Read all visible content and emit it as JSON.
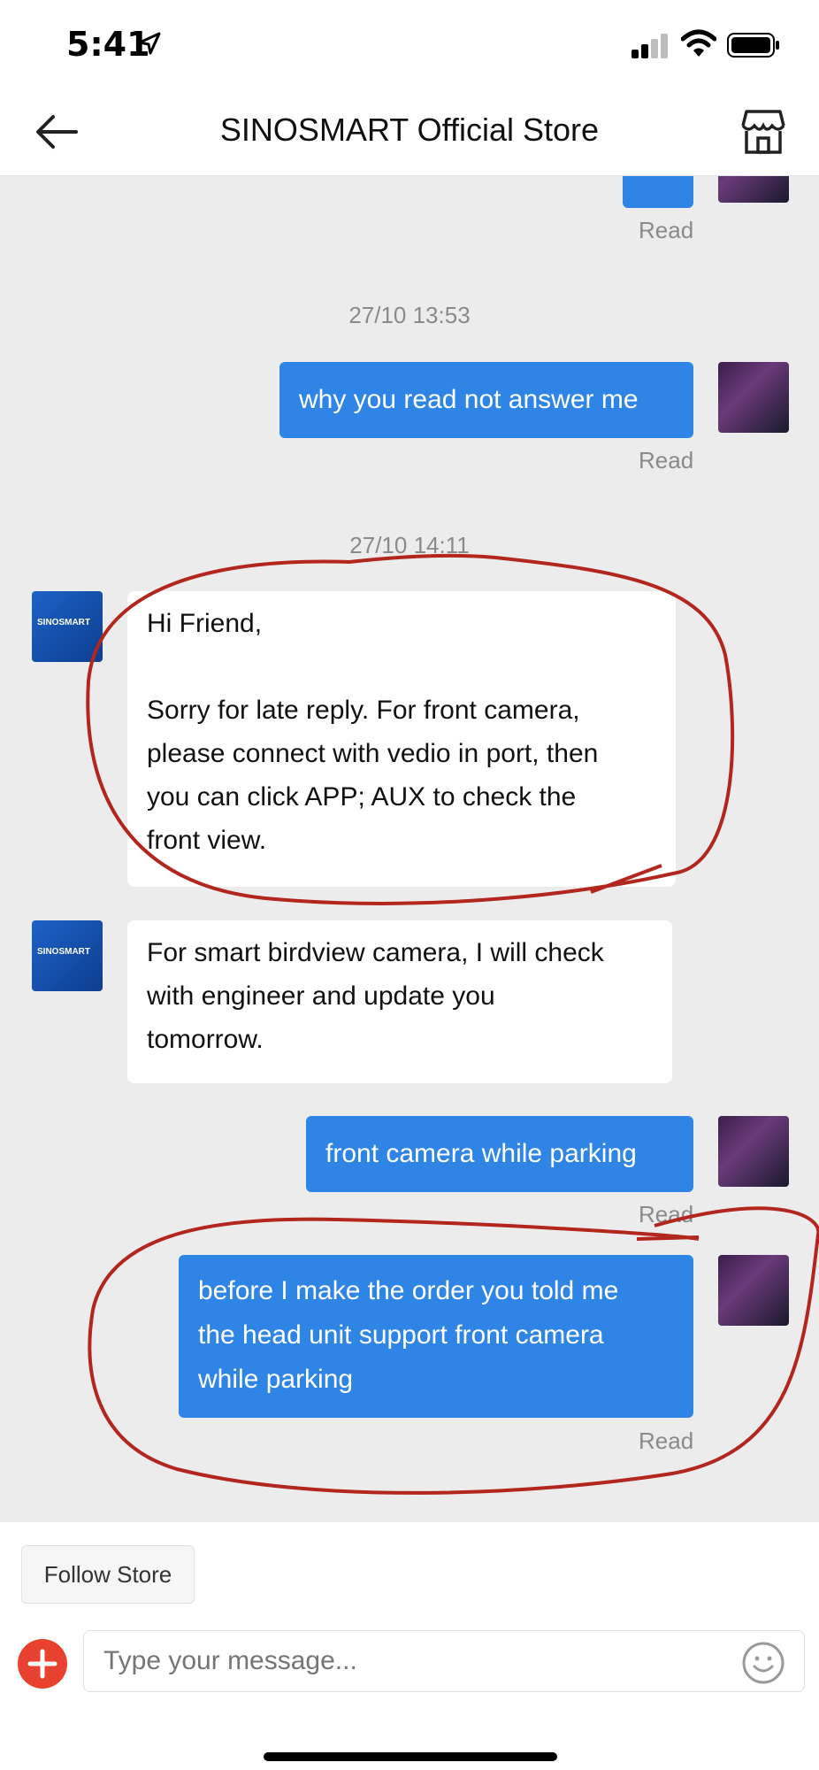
{
  "status_bar": {
    "time": "5:41"
  },
  "header": {
    "title": "SINOSMART Official Store"
  },
  "chat": {
    "top_read": "Read",
    "timestamp_1": "27/10 13:53",
    "msg_1": {
      "text": "why you read not answer me",
      "status": "Read"
    },
    "timestamp_2": "27/10 14:11",
    "msg_2": {
      "line_1": "Hi Friend,",
      "line_2": "Sorry for late reply. For front camera,",
      "line_3": "please connect with vedio in port, then",
      "line_4": "you can click APP; AUX to check the",
      "line_5": "front view."
    },
    "msg_3": {
      "line_1": "For smart birdview camera, I will check",
      "line_2": "with engineer and update you",
      "line_3": "tomorrow."
    },
    "msg_4": {
      "text": "front camera while parking",
      "status": "Read"
    },
    "msg_5": {
      "line_1": "before I make the order you told me",
      "line_2": "the head unit support front camera",
      "line_3": "while parking",
      "status": "Read"
    },
    "store_avatar_text": "SINOSMART"
  },
  "footer": {
    "follow_label": "Follow Store",
    "input_placeholder": "Type your message..."
  },
  "colors": {
    "accent": "#2f85e6",
    "annotation": "#b3261e",
    "add": "#e8412f"
  }
}
